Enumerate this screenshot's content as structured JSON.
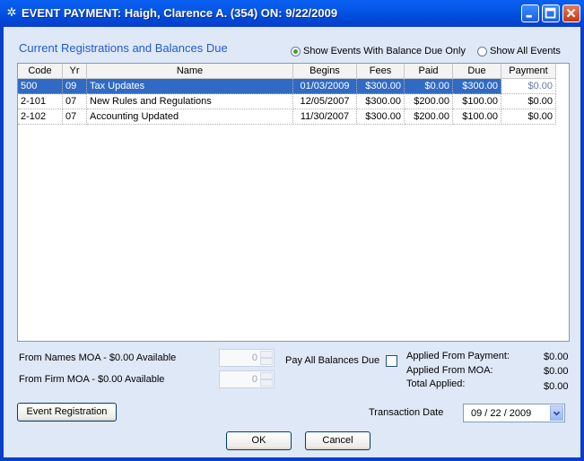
{
  "window": {
    "title": "EVENT PAYMENT: Haigh, Clarence A. (354) ON: 9/22/2009",
    "colors": {
      "titlebar": "#0456e6",
      "selection": "#316ac5",
      "section_title": "#1f5ccf"
    }
  },
  "section_title": "Current Registrations and Balances Due",
  "filters": {
    "balance_due_label": "Show Events With Balance Due Only",
    "all_events_label": "Show All Events",
    "selected": "balance_due"
  },
  "grid": {
    "columns": [
      "Code",
      "Yr",
      "Name",
      "Begins",
      "Fees",
      "Paid",
      "Due",
      "Payment"
    ],
    "rows": [
      {
        "code": "500",
        "yr": "09",
        "name": "Tax Updates",
        "begins": "01/03/2009",
        "fees": "$300.00",
        "paid": "$0.00",
        "due": "$300.00",
        "payment": "$0.00",
        "selected": true
      },
      {
        "code": "2-101",
        "yr": "07",
        "name": "New Rules and Regulations",
        "begins": "12/05/2007",
        "fees": "$300.00",
        "paid": "$200.00",
        "due": "$100.00",
        "payment": "$0.00",
        "selected": false
      },
      {
        "code": "2-102",
        "yr": "07",
        "name": "Accounting Updated",
        "begins": "11/30/2007",
        "fees": "$300.00",
        "paid": "$200.00",
        "due": "$100.00",
        "payment": "$0.00",
        "selected": false
      }
    ]
  },
  "moa": {
    "names_label": "From Names MOA - $0.00 Available",
    "names_value": "0",
    "firm_label": "From Firm MOA - $0.00 Available",
    "firm_value": "0"
  },
  "pay_all_label": "Pay All Balances Due",
  "applied": {
    "from_payment_label": "Applied From Payment:",
    "from_payment_value": "$0.00",
    "from_moa_label": "Applied From MOA:",
    "from_moa_value": "$0.00",
    "total_label": "Total Applied:",
    "total_value": "$0.00"
  },
  "event_registration_button": "Event Registration",
  "transaction_date": {
    "label": "Transaction Date",
    "value": "09 / 22 / 2009"
  },
  "buttons": {
    "ok": "OK",
    "cancel": "Cancel"
  }
}
